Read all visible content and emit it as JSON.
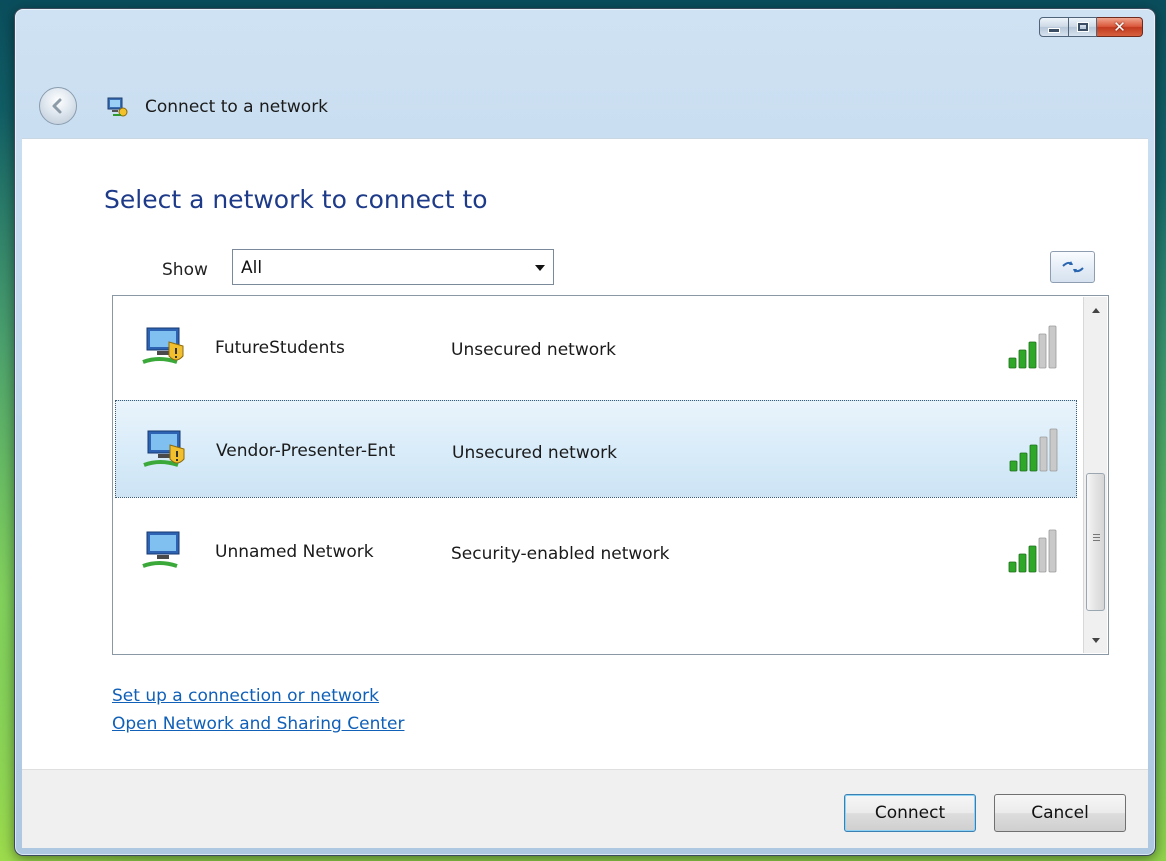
{
  "window": {
    "title": "Connect to a network",
    "caption_buttons": [
      "minimize-icon",
      "maximize-icon",
      "close-icon"
    ],
    "close_glyph": "✕"
  },
  "main": {
    "heading": "Select a network to connect to",
    "show_label": "Show",
    "show_value": "All"
  },
  "networks": [
    {
      "name": "FutureStudents",
      "security": "Unsecured network",
      "signal_bars": 5,
      "signal_strength": 3,
      "selected": false,
      "icon": "unsecured-network-icon"
    },
    {
      "name": "Vendor-Presenter-Ent",
      "security": "Unsecured network",
      "signal_bars": 5,
      "signal_strength": 3,
      "selected": true,
      "icon": "unsecured-network-icon"
    },
    {
      "name": "Unnamed Network",
      "security": "Security-enabled network",
      "signal_bars": 5,
      "signal_strength": 3,
      "selected": false,
      "icon": "secure-network-icon"
    }
  ],
  "links": {
    "setup": "Set up a connection or network",
    "sharing_center": "Open Network and Sharing Center"
  },
  "buttons": {
    "connect": "Connect",
    "cancel": "Cancel"
  },
  "colors": {
    "heading": "#1e3b8a",
    "link": "#1060b8",
    "signal_on": "#2fa82a",
    "signal_off": "#c9c9c9",
    "selection": "#d9ecf9"
  }
}
